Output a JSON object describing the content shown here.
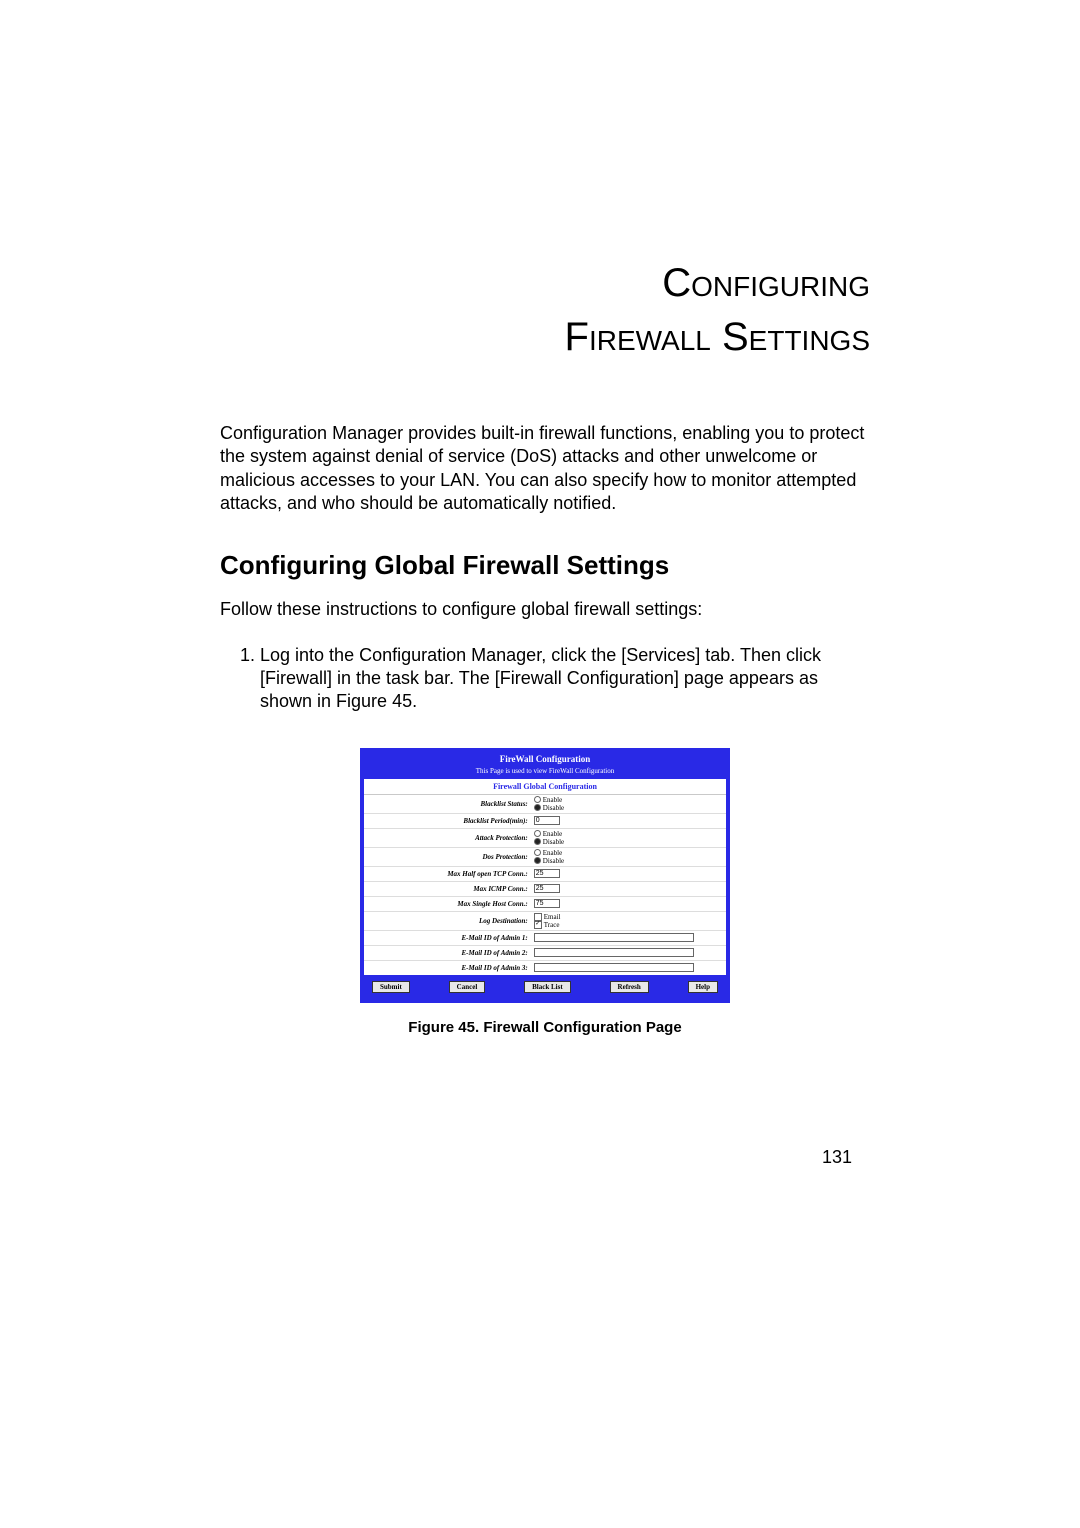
{
  "chapter": {
    "line1": "Configuring",
    "line2": "Firewall Settings"
  },
  "intro": "Configuration Manager provides built-in firewall functions, enabling you to protect the system against denial of service (DoS) attacks and other unwelcome or malicious accesses to your LAN. You can also specify how to monitor attempted attacks, and who should be automatically notified.",
  "section_heading": "Configuring Global Firewall Settings",
  "instructions_intro": "Follow these instructions to configure global firewall settings:",
  "steps": {
    "s1": "Log into the Configuration Manager, click the [Services] tab. Then click [Firewall] in the task bar. The [Firewall Configuration] page appears as shown in Figure 45."
  },
  "figure_caption": "Figure 45.  Firewall Configuration Page",
  "page_number": "131",
  "shot": {
    "title": "FireWall Configuration",
    "subtitle": "This Page is used to view FireWall Configuration",
    "global_header": "Firewall Global Configuration",
    "enable": "Enable",
    "disable": "Disable",
    "rows": {
      "blacklist_status": "Blacklist Status:",
      "blacklist_period": "Blacklist Period(min):",
      "blacklist_period_val": "0",
      "attack_protection": "Attack Protection:",
      "dos_protection": "Dos Protection:",
      "max_half_tcp": "Max Half open TCP Conn.:",
      "max_half_tcp_val": "25",
      "max_icmp": "Max ICMP Conn.:",
      "max_icmp_val": "25",
      "max_single": "Max Single Host Conn.:",
      "max_single_val": "75",
      "log_dest": "Log Destination:",
      "log_email": "Email",
      "log_trace": "Trace",
      "email1": "E-Mail ID of Admin 1:",
      "email2": "E-Mail ID of Admin 2:",
      "email3": "E-Mail ID of Admin 3:"
    },
    "buttons": {
      "submit": "Submit",
      "cancel": "Cancel",
      "blacklist": "Black List",
      "refresh": "Refresh",
      "help": "Help"
    }
  }
}
